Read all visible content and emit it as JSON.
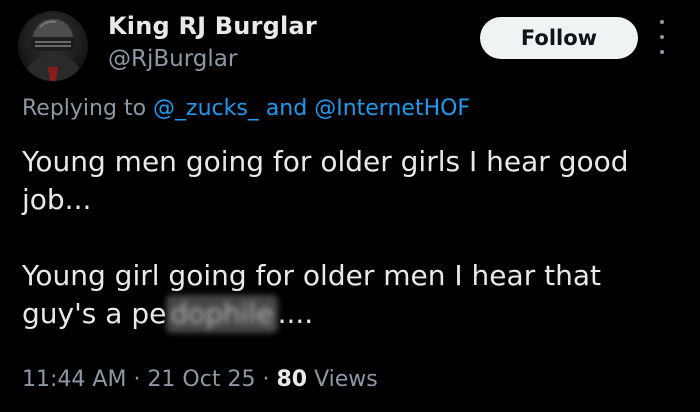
{
  "author": {
    "display_name": "King RJ Burglar",
    "handle": "@RjBurglar"
  },
  "follow_label": "Follow",
  "reply_context": {
    "prefix": "Replying to",
    "mention_1": "@_zucks_",
    "joiner": "and",
    "mention_2": "@InternetHOF"
  },
  "body": {
    "paragraph_1": "Young men going for older girls I hear good job...",
    "paragraph_2_before": "Young girl going for older men I hear that guy's a pe",
    "paragraph_2_blurred": "dophile",
    "paragraph_2_after": "...."
  },
  "meta": {
    "time": "11:44 AM",
    "separator": "·",
    "date": "21 Oct 25",
    "views_count": "80",
    "views_label": "Views"
  },
  "colors": {
    "background": "#000000",
    "primary_text": "#e7e9ea",
    "secondary_text": "#8b98a5",
    "link": "#1d9bf0",
    "button_bg": "#eff3f4"
  },
  "icons": {
    "more": "more-vertical-icon"
  }
}
